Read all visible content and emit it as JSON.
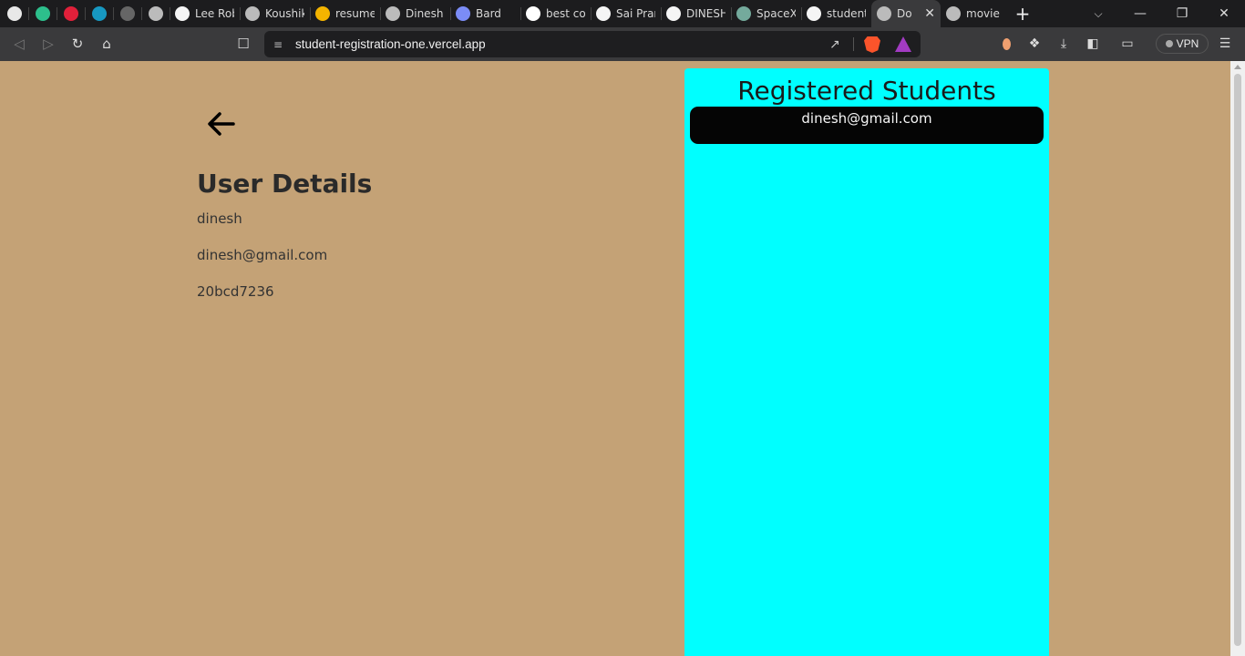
{
  "browser": {
    "tabs": [
      {
        "title": "",
        "icon": "notification-bell-icon",
        "color": "#e8e8e8"
      },
      {
        "title": "",
        "icon": "t-logo-icon",
        "color": "#2dbf8c"
      },
      {
        "title": "",
        "icon": "tuf-logo-icon",
        "color": "#e0203a"
      },
      {
        "title": "",
        "icon": "salesforce-cloud-icon",
        "color": "#1798c1"
      },
      {
        "title": "",
        "icon": "wi-logo-icon",
        "color": "#666666"
      },
      {
        "title": "",
        "icon": "globe-icon",
        "color": "#bbbbbb"
      },
      {
        "title": "Lee Rob",
        "icon": "leerob-logo-icon",
        "color": "#f5f5f5"
      },
      {
        "title": "Koushik",
        "icon": "globe-icon",
        "color": "#bbbbbb"
      },
      {
        "title": "resume",
        "icon": "google-drive-icon",
        "color": "#f4b400"
      },
      {
        "title": "Dinesh",
        "icon": "globe-icon",
        "color": "#bbbbbb"
      },
      {
        "title": "Bard",
        "icon": "bard-sparkle-icon",
        "color": "#7b8cf6"
      },
      {
        "title": "best co",
        "icon": "google-icon",
        "color": "#ffffff"
      },
      {
        "title": "Sai Pran",
        "icon": "vercel-triangle-icon",
        "color": "#f5f5f5"
      },
      {
        "title": "DINESH",
        "icon": "github-icon",
        "color": "#f5f5f5"
      },
      {
        "title": "SpaceX",
        "icon": "chatgpt-icon",
        "color": "#74aa9c"
      },
      {
        "title": "student",
        "icon": "vercel-triangle-icon",
        "color": "#f5f5f5"
      },
      {
        "title": "Do",
        "icon": "globe-icon",
        "color": "#bbbbbb",
        "active": true
      },
      {
        "title": "movie",
        "icon": "globe-icon",
        "color": "#bbbbbb"
      }
    ],
    "url": "student-registration-one.vercel.app",
    "vpn_label": "VPN"
  },
  "page": {
    "user_details": {
      "heading": "User Details",
      "name": "dinesh",
      "email": "dinesh@gmail.com",
      "id": "20bcd7236"
    },
    "registered": {
      "heading": "Registered Students",
      "students": [
        "dinesh@gmail.com"
      ]
    }
  },
  "colors": {
    "page_bg": "#c4a276",
    "panel_bg": "#00ffff",
    "card_bg": "#050505"
  }
}
